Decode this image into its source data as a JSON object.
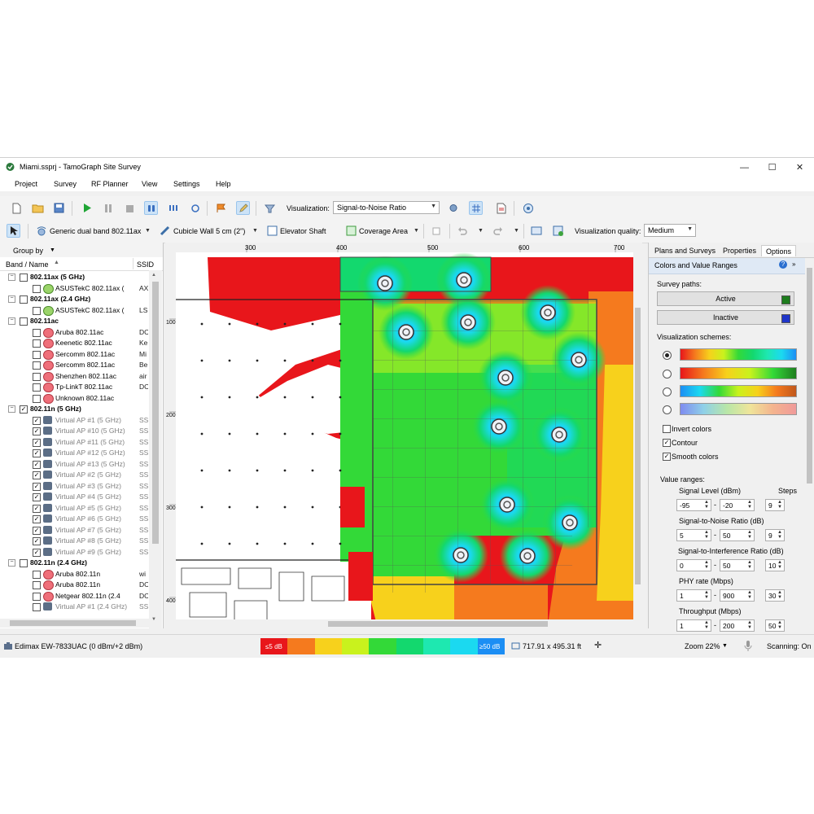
{
  "window": {
    "title": "Miami.ssprj - TamoGraph Site Survey",
    "controls": {
      "minimize": "—",
      "maximize": "☐",
      "close": "✕"
    }
  },
  "menu": [
    "Project",
    "Survey",
    "RF Planner",
    "View",
    "Settings",
    "Help"
  ],
  "toolbar1": {
    "visualization_label": "Visualization:",
    "visualization_value": "Signal-to-Noise Ratio"
  },
  "toolbar2": {
    "ap_tool": "Generic dual band 802.11ax",
    "wall_tool": "Cubicle Wall 5 cm (2\")",
    "elevator_tool": "Elevator Shaft",
    "coverage_tool": "Coverage Area",
    "quality_label": "Visualization quality:",
    "quality_value": "Medium"
  },
  "left_panel": {
    "group_by": "Group by",
    "col_name": "Band / Name",
    "col_ssid": "SSID",
    "rows": [
      {
        "level": 0,
        "label": "802.11ax (5 GHz)",
        "checked": false,
        "ssid": ""
      },
      {
        "level": 1,
        "label": "ASUSTekC 802.11ax (",
        "checked": false,
        "ssid": "AX",
        "icon": "asus"
      },
      {
        "level": 0,
        "label": "802.11ax (2.4 GHz)",
        "checked": false,
        "ssid": ""
      },
      {
        "level": 1,
        "label": "ASUSTekC 802.11ax (",
        "checked": false,
        "ssid": "LS",
        "icon": "asus"
      },
      {
        "level": 0,
        "label": "802.11ac",
        "checked": false,
        "ssid": ""
      },
      {
        "level": 1,
        "label": "Aruba 802.11ac",
        "checked": false,
        "ssid": "DC",
        "icon": "red"
      },
      {
        "level": 1,
        "label": "Keenetic 802.11ac",
        "checked": false,
        "ssid": "Ke",
        "icon": "red"
      },
      {
        "level": 1,
        "label": "Sercomm 802.11ac",
        "checked": false,
        "ssid": "Mi",
        "icon": "red"
      },
      {
        "level": 1,
        "label": "Sercomm 802.11ac",
        "checked": false,
        "ssid": "Be",
        "icon": "red"
      },
      {
        "level": 1,
        "label": "Shenzhen 802.11ac",
        "checked": false,
        "ssid": "air",
        "icon": "red"
      },
      {
        "level": 1,
        "label": "Tp-LinkT 802.11ac",
        "checked": false,
        "ssid": "DC",
        "icon": "red"
      },
      {
        "level": 1,
        "label": "Unknown 802.11ac",
        "checked": false,
        "ssid": "",
        "icon": "red"
      },
      {
        "level": 0,
        "label": "802.11n (5 GHz)",
        "checked": true,
        "ssid": ""
      },
      {
        "level": 1,
        "label": "Virtual AP #1 (5 GHz)",
        "checked": true,
        "ssid": "SS",
        "icon": "virtual",
        "gray": true
      },
      {
        "level": 1,
        "label": "Virtual AP #10 (5 GHz)",
        "checked": true,
        "ssid": "SS",
        "icon": "virtual",
        "gray": true
      },
      {
        "level": 1,
        "label": "Virtual AP #11 (5 GHz)",
        "checked": true,
        "ssid": "SS",
        "icon": "virtual",
        "gray": true
      },
      {
        "level": 1,
        "label": "Virtual AP #12 (5 GHz)",
        "checked": true,
        "ssid": "SS",
        "icon": "virtual",
        "gray": true
      },
      {
        "level": 1,
        "label": "Virtual AP #13 (5 GHz)",
        "checked": true,
        "ssid": "SS",
        "icon": "virtual",
        "gray": true
      },
      {
        "level": 1,
        "label": "Virtual AP #2 (5 GHz)",
        "checked": true,
        "ssid": "SS",
        "icon": "virtual",
        "gray": true
      },
      {
        "level": 1,
        "label": "Virtual AP #3 (5 GHz)",
        "checked": true,
        "ssid": "SS",
        "icon": "virtual",
        "gray": true
      },
      {
        "level": 1,
        "label": "Virtual AP #4 (5 GHz)",
        "checked": true,
        "ssid": "SS",
        "icon": "virtual",
        "gray": true
      },
      {
        "level": 1,
        "label": "Virtual AP #5 (5 GHz)",
        "checked": true,
        "ssid": "SS",
        "icon": "virtual",
        "gray": true
      },
      {
        "level": 1,
        "label": "Virtual AP #6 (5 GHz)",
        "checked": true,
        "ssid": "SS",
        "icon": "virtual",
        "gray": true
      },
      {
        "level": 1,
        "label": "Virtual AP #7 (5 GHz)",
        "checked": true,
        "ssid": "SS",
        "icon": "virtual",
        "gray": true
      },
      {
        "level": 1,
        "label": "Virtual AP #8 (5 GHz)",
        "checked": true,
        "ssid": "SS",
        "icon": "virtual",
        "gray": true
      },
      {
        "level": 1,
        "label": "Virtual AP #9 (5 GHz)",
        "checked": true,
        "ssid": "SS",
        "icon": "virtual",
        "gray": true
      },
      {
        "level": 0,
        "label": "802.11n (2.4 GHz)",
        "checked": false,
        "ssid": ""
      },
      {
        "level": 1,
        "label": "Aruba 802.11n",
        "checked": false,
        "ssid": "wi",
        "icon": "red"
      },
      {
        "level": 1,
        "label": "Aruba 802.11n",
        "checked": false,
        "ssid": "DC",
        "icon": "red"
      },
      {
        "level": 1,
        "label": "Netgear 802.11n (2.4",
        "checked": false,
        "ssid": "DC",
        "icon": "red"
      },
      {
        "level": 1,
        "label": "Virtual AP #1 (2.4 GHz)",
        "checked": false,
        "ssid": "SS",
        "icon": "virtual",
        "gray": true
      }
    ]
  },
  "map": {
    "ruler_top": [
      "300",
      "400",
      "500",
      "600",
      "700"
    ],
    "ruler_left": [
      "100",
      "200",
      "300",
      "400"
    ],
    "ap_count": 13
  },
  "right_panel": {
    "tabs": [
      "Plans and Surveys",
      "Properties",
      "Options"
    ],
    "active_tab": "Options",
    "section_title": "Colors and Value Ranges",
    "survey_paths_label": "Survey paths:",
    "active_label": "Active",
    "active_color": "#1e7d1e",
    "inactive_label": "Inactive",
    "inactive_color": "#1f35c9",
    "schemes_label": "Visualization schemes:",
    "invert_colors": "Invert colors",
    "invert_checked": false,
    "contour": "Contour",
    "contour_checked": true,
    "smooth_colors": "Smooth colors",
    "smooth_checked": true,
    "value_ranges_label": "Value ranges:",
    "steps_label": "Steps",
    "ranges": [
      {
        "label": "Signal Level (dBm)",
        "min": "-95",
        "max": "-20",
        "steps": "9"
      },
      {
        "label": "Signal-to-Noise Ratio (dB)",
        "min": "5",
        "max": "50",
        "steps": "9"
      },
      {
        "label": "Signal-to-Interference Ratio (dB)",
        "min": "0",
        "max": "50",
        "steps": "10"
      },
      {
        "label": "PHY rate (Mbps)",
        "min": "1",
        "max": "900",
        "steps": "30"
      },
      {
        "label": "Throughput (Mbps)",
        "min": "1",
        "max": "200",
        "steps": "50"
      }
    ]
  },
  "status": {
    "adapter": "Edimax EW-7833UAC (0 dBm/+2 dBm)",
    "legend_min": "≤5 dB",
    "legend_max": "≥50 dB",
    "legend_colors": [
      "#e8161b",
      "#f57a1e",
      "#f7d11c",
      "#c9f21d",
      "#33d938",
      "#13d86e",
      "#1ee8b0",
      "#1bd9f0",
      "#1c8ef4"
    ],
    "dimensions": "717.91 x 495.31 ft",
    "zoom": "Zoom 22%",
    "scanning": "Scanning: On"
  }
}
